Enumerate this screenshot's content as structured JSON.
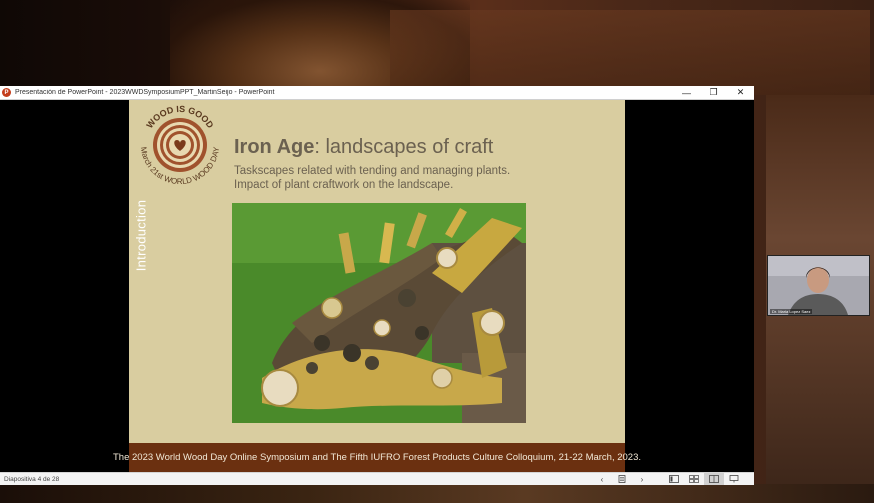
{
  "window": {
    "title": "Presentación de PowerPoint  -  2023WWDSymposiumPPT_MartinSeijo  -  PowerPoint",
    "app_icon_letter": "P",
    "minimize_glyph": "—",
    "maximize_glyph": "❐",
    "close_glyph": "✕"
  },
  "slide": {
    "badge_top_text": "WOOD IS GOOD",
    "badge_bottom_text": "March 21st WORLD WOOD DAY",
    "sidebar_label": "Introduction",
    "title_bold": "Iron Age",
    "title_rest": ": landscapes of craft",
    "subtitle_line1": "Taskscapes related with tending and managing plants.",
    "subtitle_line2": "Impact of plant craftwork on the landscape.",
    "footer": "The 2023 World Wood Day Online Symposium and The Fifth IUFRO Forest Products Culture Colloquium, 21-22 March, 2023."
  },
  "statusbar": {
    "slide_counter": "Diapositiva 4 de 28",
    "prev_glyph": "‹",
    "next_glyph": "›"
  },
  "participant": {
    "name": "Dr. Maria Lopez Saez"
  },
  "colors": {
    "slide_bg": "#d9cda0",
    "title_text": "#6b6150",
    "footer_bg": "#6b3010",
    "footer_text": "#f2e8d6",
    "badge_ring": "#a0522d",
    "powerpoint_brand": "#c43e1c"
  }
}
